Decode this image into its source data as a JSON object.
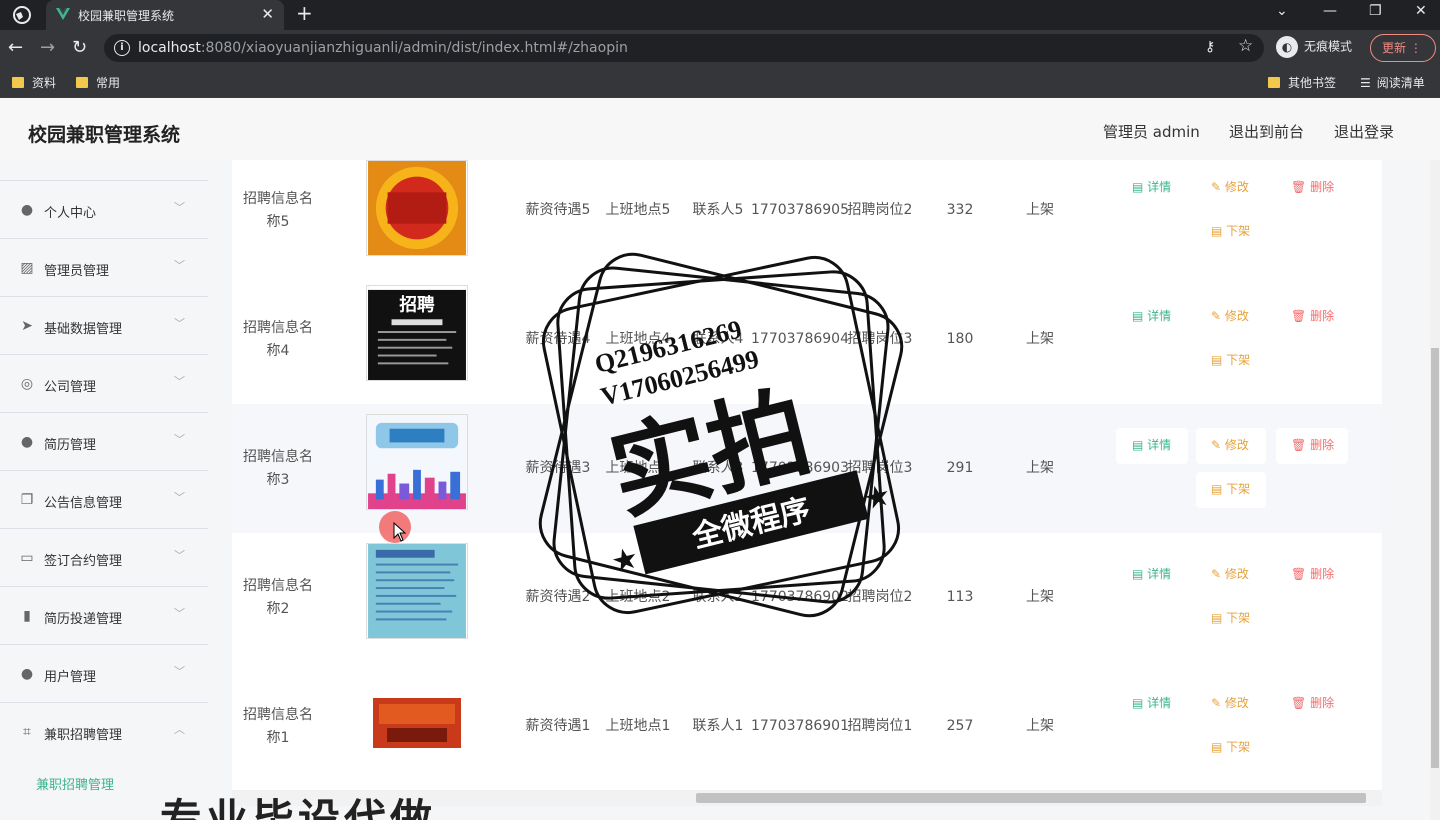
{
  "browser": {
    "tab_title": "校园兼职管理系统",
    "url_host": "localhost",
    "url_rest": ":8080/xiaoyuanjianzhiguanli/admin/dist/index.html#/zhaopin",
    "incognito_label": "无痕模式",
    "update_label": "更新",
    "bookmarks": [
      "资料",
      "常用"
    ],
    "bookmarks_right": [
      "其他书签",
      "阅读清单"
    ]
  },
  "header": {
    "title": "校园兼职管理系统",
    "admin_label": "管理员 admin",
    "front_label": "退出到前台",
    "logout_label": "退出登录"
  },
  "sidebar": {
    "items": [
      {
        "label": "个人中心",
        "icon": "user-icon"
      },
      {
        "label": "管理员管理",
        "icon": "chart-icon"
      },
      {
        "label": "基础数据管理",
        "icon": "send-icon"
      },
      {
        "label": "公司管理",
        "icon": "compass-icon"
      },
      {
        "label": "简历管理",
        "icon": "user-icon"
      },
      {
        "label": "公告信息管理",
        "icon": "copy-icon"
      },
      {
        "label": "签订合约管理",
        "icon": "id-card-icon"
      },
      {
        "label": "简历投递管理",
        "icon": "bar-chart-icon"
      },
      {
        "label": "用户管理",
        "icon": "user-icon"
      },
      {
        "label": "兼职招聘管理",
        "icon": "crop-icon"
      }
    ],
    "active_sub": "兼职招聘管理"
  },
  "table": {
    "actions": {
      "detail": "详情",
      "edit": "修改",
      "delete": "删除",
      "down": "下架"
    },
    "rows": [
      {
        "name": "招聘信息名称5",
        "salary": "薪资待遇5",
        "place": "上班地点5",
        "contact": "联系人5",
        "phone": "17703786905",
        "post": "招聘岗位2",
        "count": "332",
        "status": "上架"
      },
      {
        "name": "招聘信息名称4",
        "salary": "薪资待遇4",
        "place": "上班地点4",
        "contact": "联系人4",
        "phone": "17703786904",
        "post": "招聘岗位3",
        "count": "180",
        "status": "上架"
      },
      {
        "name": "招聘信息名称3",
        "salary": "薪资待遇3",
        "place": "上班地点3",
        "contact": "联系人3",
        "phone": "17703786903",
        "post": "招聘岗位3",
        "count": "291",
        "status": "上架"
      },
      {
        "name": "招聘信息名称2",
        "salary": "薪资待遇2",
        "place": "上班地点2",
        "contact": "联系人2",
        "phone": "17703786902",
        "post": "招聘岗位2",
        "count": "113",
        "status": "上架"
      },
      {
        "name": "招聘信息名称1",
        "salary": "薪资待遇1",
        "place": "上班地点1",
        "contact": "联系人1",
        "phone": "17703786901",
        "post": "招聘岗位1",
        "count": "257",
        "status": "上架"
      }
    ]
  },
  "watermark": {
    "line1": "Q2196316269",
    "line2": "V17060256499",
    "big": "实拍",
    "ribbon": "全微程序",
    "bottom": "专业毕设代做"
  }
}
